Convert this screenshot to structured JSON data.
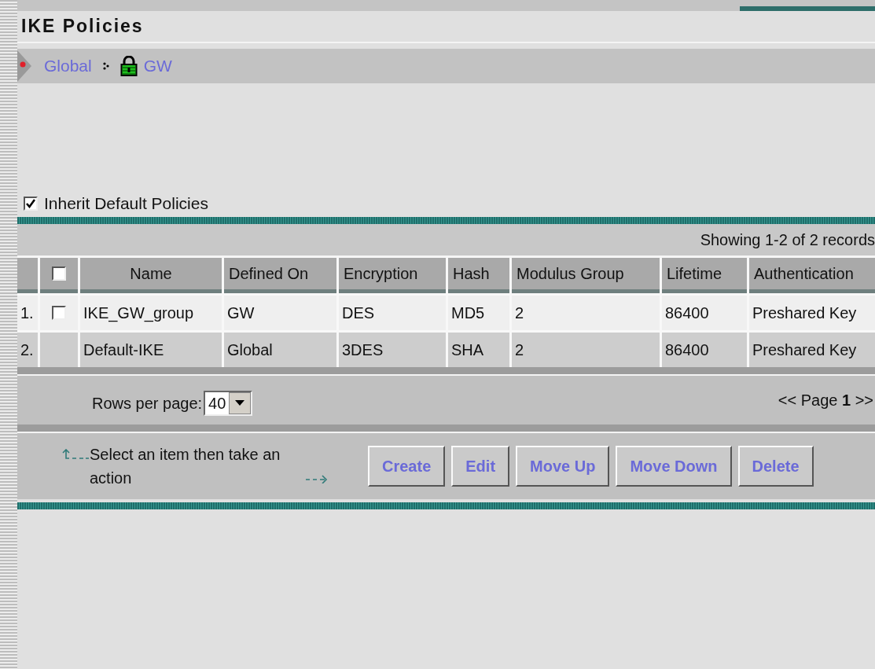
{
  "page": {
    "title": "IKE Policies"
  },
  "breadcrumb": [
    {
      "label": "Global",
      "kind": "scope"
    },
    {
      "label": "GW",
      "kind": "device"
    }
  ],
  "inherit": {
    "label": "Inherit Default Policies",
    "checked": true
  },
  "table": {
    "record_count": "Showing 1-2 of 2 records",
    "select_all": {
      "checked": false
    },
    "columns": [
      "Name",
      "Defined On",
      "Encryption",
      "Hash",
      "Modulus Group",
      "Lifetime",
      "Authentication"
    ],
    "rows": [
      {
        "number": "1.",
        "kind": "selectable",
        "selected": false,
        "cells": [
          "IKE_GW_group",
          "GW",
          "DES",
          "MD5",
          "2",
          "86400",
          "Preshared Key"
        ]
      },
      {
        "number": "2.",
        "kind": "fixed",
        "cells": [
          "Default-IKE",
          "Global",
          "3DES",
          "SHA",
          "2",
          "86400",
          "Preshared Key"
        ]
      }
    ]
  },
  "paging": {
    "rows_label": "Rows per page:",
    "rows_value": "40",
    "pages": "<< Page **1** >>"
  },
  "actions": {
    "hint": "Select an item then take an action",
    "buttons": [
      "Create",
      "Edit",
      "Move Up",
      "Move Down",
      "Delete"
    ]
  }
}
